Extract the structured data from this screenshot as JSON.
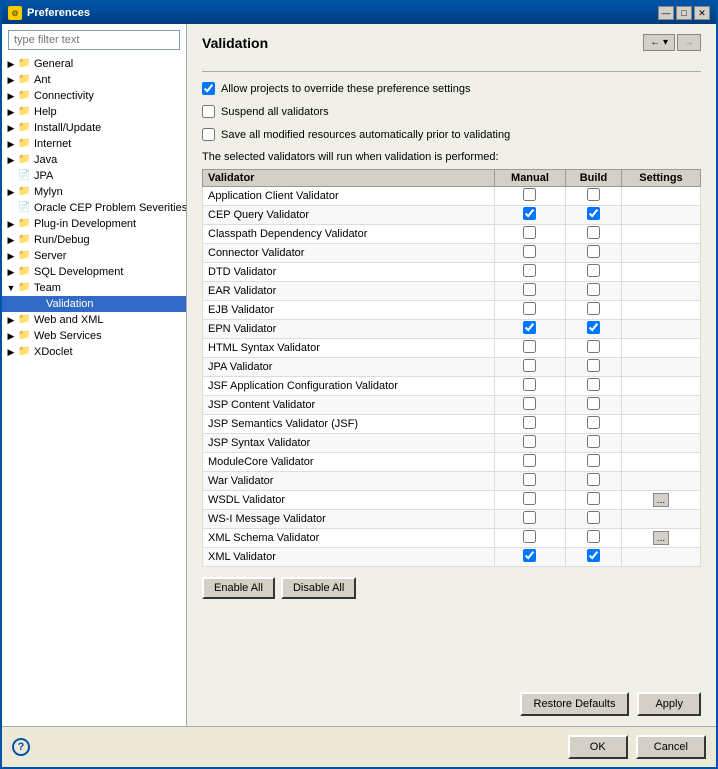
{
  "window": {
    "title": "Preferences",
    "icon": "⚙"
  },
  "title_buttons": {
    "minimize": "—",
    "maximize": "□",
    "close": "✕"
  },
  "sidebar": {
    "filter_placeholder": "type filter text",
    "items": [
      {
        "id": "general",
        "label": "General",
        "level": 1,
        "type": "collapsed",
        "selected": false
      },
      {
        "id": "ant",
        "label": "Ant",
        "level": 1,
        "type": "collapsed",
        "selected": false
      },
      {
        "id": "connectivity",
        "label": "Connectivity",
        "level": 1,
        "type": "collapsed",
        "selected": false
      },
      {
        "id": "help",
        "label": "Help",
        "level": 1,
        "type": "collapsed",
        "selected": false
      },
      {
        "id": "install-update",
        "label": "Install/Update",
        "level": 1,
        "type": "collapsed",
        "selected": false
      },
      {
        "id": "internet",
        "label": "Internet",
        "level": 1,
        "type": "collapsed",
        "selected": false
      },
      {
        "id": "java",
        "label": "Java",
        "level": 1,
        "type": "collapsed",
        "selected": false
      },
      {
        "id": "jpa",
        "label": "JPA",
        "level": 1,
        "type": "leaf",
        "selected": false
      },
      {
        "id": "mylyn",
        "label": "Mylyn",
        "level": 1,
        "type": "collapsed",
        "selected": false
      },
      {
        "id": "oracle-cep",
        "label": "Oracle CEP Problem Severities",
        "level": 1,
        "type": "leaf",
        "selected": false
      },
      {
        "id": "plugin-dev",
        "label": "Plug-in Development",
        "level": 1,
        "type": "collapsed",
        "selected": false
      },
      {
        "id": "run-debug",
        "label": "Run/Debug",
        "level": 1,
        "type": "collapsed",
        "selected": false
      },
      {
        "id": "server",
        "label": "Server",
        "level": 1,
        "type": "collapsed",
        "selected": false
      },
      {
        "id": "sql-dev",
        "label": "SQL Development",
        "level": 1,
        "type": "collapsed",
        "selected": false
      },
      {
        "id": "team",
        "label": "Team",
        "level": 1,
        "type": "expanded",
        "selected": false
      },
      {
        "id": "validation",
        "label": "Validation",
        "level": 2,
        "type": "leaf",
        "selected": true
      },
      {
        "id": "web-xml",
        "label": "Web and XML",
        "level": 1,
        "type": "collapsed",
        "selected": false
      },
      {
        "id": "web-services",
        "label": "Web Services",
        "level": 1,
        "type": "collapsed",
        "selected": false
      },
      {
        "id": "xdoclet",
        "label": "XDoclet",
        "level": 1,
        "type": "collapsed",
        "selected": false
      }
    ]
  },
  "panel": {
    "title": "Validation",
    "allow_override_label": "Allow projects to override these preference settings",
    "suspend_label": "Suspend all validators",
    "save_label": "Save all modified resources automatically prior to validating",
    "section_desc": "The selected validators will run when validation is performed:",
    "table": {
      "headers": [
        "Validator",
        "Manual",
        "Build",
        "Settings"
      ],
      "rows": [
        {
          "name": "Application Client Validator",
          "manual": false,
          "build": false,
          "settings": false
        },
        {
          "name": "CEP Query Validator",
          "manual": true,
          "build": true,
          "settings": false
        },
        {
          "name": "Classpath Dependency Validator",
          "manual": false,
          "build": false,
          "settings": false
        },
        {
          "name": "Connector Validator",
          "manual": false,
          "build": false,
          "settings": false
        },
        {
          "name": "DTD Validator",
          "manual": false,
          "build": false,
          "settings": false
        },
        {
          "name": "EAR Validator",
          "manual": false,
          "build": false,
          "settings": false
        },
        {
          "name": "EJB Validator",
          "manual": false,
          "build": false,
          "settings": false
        },
        {
          "name": "EPN Validator",
          "manual": true,
          "build": true,
          "settings": false
        },
        {
          "name": "HTML Syntax Validator",
          "manual": false,
          "build": false,
          "settings": false
        },
        {
          "name": "JPA Validator",
          "manual": false,
          "build": false,
          "settings": false
        },
        {
          "name": "JSF Application Configuration Validator",
          "manual": false,
          "build": false,
          "settings": false
        },
        {
          "name": "JSP Content Validator",
          "manual": false,
          "build": false,
          "settings": false
        },
        {
          "name": "JSP Semantics Validator (JSF)",
          "manual": false,
          "build": false,
          "settings": false
        },
        {
          "name": "JSP Syntax Validator",
          "manual": false,
          "build": false,
          "settings": false
        },
        {
          "name": "ModuleCore Validator",
          "manual": false,
          "build": false,
          "settings": false
        },
        {
          "name": "War Validator",
          "manual": false,
          "build": false,
          "settings": false
        },
        {
          "name": "WSDL Validator",
          "manual": false,
          "build": false,
          "settings": true
        },
        {
          "name": "WS-I Message Validator",
          "manual": false,
          "build": false,
          "settings": false
        },
        {
          "name": "XML Schema Validator",
          "manual": false,
          "build": false,
          "settings": true
        },
        {
          "name": "XML Validator",
          "manual": true,
          "build": true,
          "settings": false
        }
      ]
    },
    "enable_all_label": "Enable All",
    "disable_all_label": "Disable All",
    "restore_defaults_label": "Restore Defaults",
    "apply_label": "Apply"
  },
  "footer": {
    "ok_label": "OK",
    "cancel_label": "Cancel",
    "help_symbol": "?"
  }
}
